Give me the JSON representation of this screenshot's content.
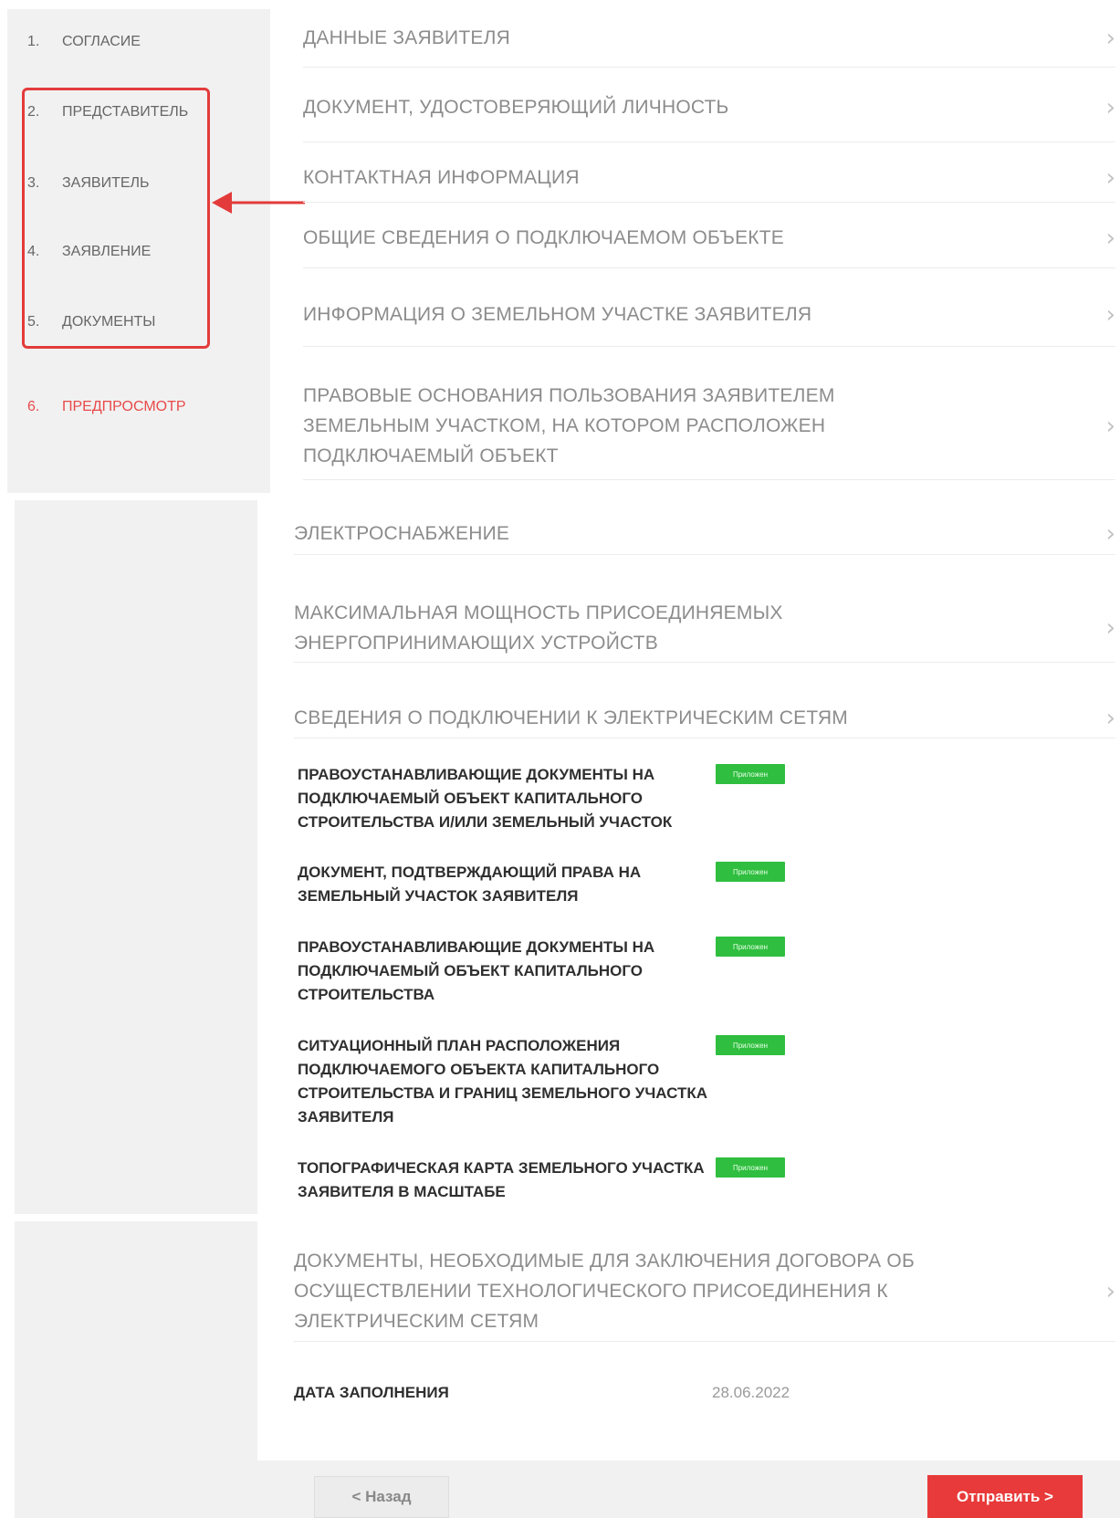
{
  "steps": [
    {
      "num": "1.",
      "label": "СОГЛАСИЕ"
    },
    {
      "num": "2.",
      "label": "ПРЕДСТАВИТЕЛЬ"
    },
    {
      "num": "3.",
      "label": "ЗАЯВИТЕЛЬ"
    },
    {
      "num": "4.",
      "label": "ЗАЯВЛЕНИЕ"
    },
    {
      "num": "5.",
      "label": "ДОКУМЕНТЫ"
    },
    {
      "num": "6.",
      "label": "ПРЕДПРОСМОТР"
    }
  ],
  "sections": [
    "ДАННЫЕ ЗАЯВИТЕЛЯ",
    "ДОКУМЕНТ, УДОСТОВЕРЯЮЩИЙ ЛИЧНОСТЬ",
    "КОНТАКТНАЯ ИНФОРМАЦИЯ",
    "ОБЩИЕ СВЕДЕНИЯ О ПОДКЛЮЧАЕМОМ ОБЪЕКТЕ",
    "ИНФОРМАЦИЯ О ЗЕМЕЛЬНОМ УЧАСТКЕ ЗАЯВИТЕЛЯ",
    "ПРАВОВЫЕ ОСНОВАНИЯ ПОЛЬЗОВАНИЯ ЗАЯВИТЕЛЕМ ЗЕМЕЛЬНЫМ УЧАСТКОМ, НА КОТОРОМ РАСПОЛОЖЕН ПОДКЛЮЧАЕМЫЙ ОБЪЕКТ",
    "ЭЛЕКТРОСНАБЖЕНИЕ",
    "МАКСИМАЛЬНАЯ МОЩНОСТЬ ПРИСОЕДИНЯЕМЫХ ЭНЕРГОПРИНИМАЮЩИХ УСТРОЙСТВ",
    "СВЕДЕНИЯ О ПОДКЛЮЧЕНИИ К ЭЛЕКТРИЧЕСКИМ СЕТЯМ",
    "ДОКУМЕНТЫ, НЕОБХОДИМЫЕ ДЛЯ ЗАКЛЮЧЕНИЯ ДОГОВОРА ОБ ОСУЩЕСТВЛЕНИИ ТЕХНОЛОГИЧЕСКОГО ПРИСОЕДИНЕНИЯ К ЭЛЕКТРИЧЕСКИМ СЕТЯМ"
  ],
  "documents": [
    {
      "title": "ПРАВОУСТАНАВЛИВАЮЩИЕ ДОКУМЕНТЫ НА ПОДКЛЮЧАЕМЫЙ ОБЪЕКТ КАПИТАЛЬНОГО СТРОИТЕЛЬСТВА И/ИЛИ ЗЕМЕЛЬНЫЙ УЧАСТОК",
      "badge": "Приложен"
    },
    {
      "title": "ДОКУМЕНТ, ПОДТВЕРЖДАЮЩИЙ ПРАВА НА ЗЕМЕЛЬНЫЙ УЧАСТОК ЗАЯВИТЕЛЯ",
      "badge": "Приложен"
    },
    {
      "title": "ПРАВОУСТАНАВЛИВАЮЩИЕ ДОКУМЕНТЫ НА ПОДКЛЮЧАЕМЫЙ ОБЪЕКТ КАПИТАЛЬНОГО СТРОИТЕЛЬСТВА",
      "badge": "Приложен"
    },
    {
      "title": "СИТУАЦИОННЫЙ ПЛАН РАСПОЛОЖЕНИЯ ПОДКЛЮЧАЕМОГО ОБЪЕКТА КАПИТАЛЬНОГО СТРОИТЕЛЬСТВА И ГРАНИЦ ЗЕМЕЛЬНОГО УЧАСТКА ЗАЯВИТЕЛЯ",
      "badge": "Приложен"
    },
    {
      "title": "ТОПОГРАФИЧЕСКАЯ КАРТА ЗЕМЕЛЬНОГО УЧАСТКА ЗАЯВИТЕЛЯ В МАСШТАБЕ",
      "badge": "Приложен"
    }
  ],
  "date": {
    "label": "ДАТА ЗАПОЛНЕНИЯ",
    "value": "28.06.2022"
  },
  "buttons": {
    "back": "< Назад",
    "send": "Отправить >"
  },
  "chevron": "›",
  "colors": {
    "accent": "#e83a3a",
    "badge": "#2fbe3f",
    "sidebar": "#f1f1f1"
  }
}
